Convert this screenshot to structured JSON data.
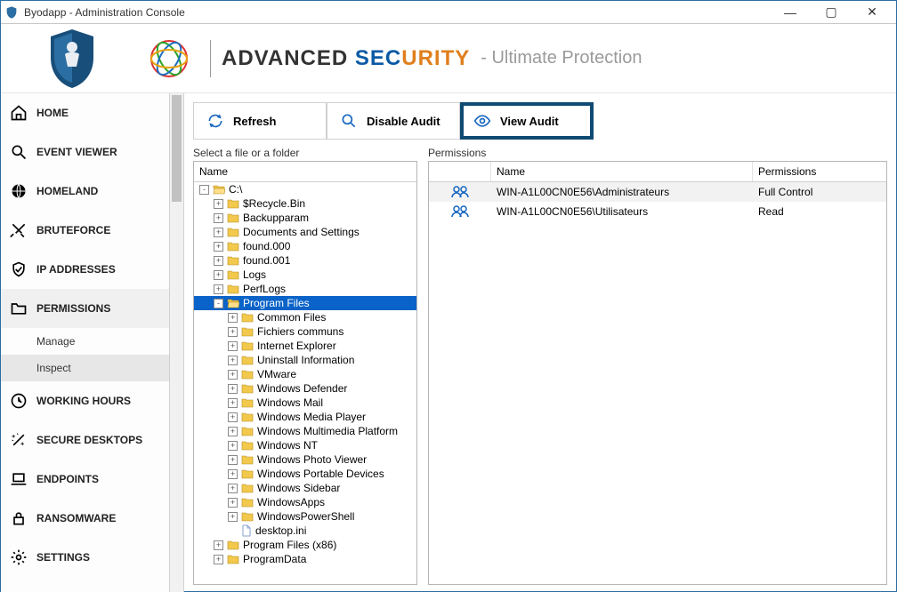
{
  "window": {
    "title": "Byodapp - Administration Console"
  },
  "brand": {
    "word1": "ADVANCED ",
    "word2a": "SEC",
    "word2b": "URITY",
    "tagline": "- Ultimate Protection"
  },
  "sidebar": {
    "items": [
      {
        "label": "HOME",
        "icon": "home-icon"
      },
      {
        "label": "EVENT VIEWER",
        "icon": "search-icon"
      },
      {
        "label": "HOMELAND",
        "icon": "globe-icon"
      },
      {
        "label": "BRUTEFORCE",
        "icon": "swords-icon"
      },
      {
        "label": "IP ADDRESSES",
        "icon": "shield-check-icon"
      },
      {
        "label": "PERMISSIONS",
        "icon": "folder-icon",
        "selected": true,
        "sub": [
          {
            "label": "Manage"
          },
          {
            "label": "Inspect",
            "selected": true
          }
        ]
      },
      {
        "label": "WORKING HOURS",
        "icon": "clock-icon"
      },
      {
        "label": "SECURE DESKTOPS",
        "icon": "wand-icon"
      },
      {
        "label": "ENDPOINTS",
        "icon": "laptop-icon"
      },
      {
        "label": "RANSOMWARE",
        "icon": "lock-icon"
      },
      {
        "label": "SETTINGS",
        "icon": "gear-icon"
      }
    ]
  },
  "toolbar": {
    "refresh": "Refresh",
    "disable_audit": "Disable Audit",
    "view_audit": "View Audit"
  },
  "left_panel": {
    "title": "Select a file or a folder",
    "header": "Name"
  },
  "right_panel": {
    "title": "Permissions",
    "col_name": "Name",
    "col_perm": "Permissions"
  },
  "tree": [
    {
      "depth": 0,
      "twisty": "-",
      "kind": "folder-open",
      "label": "C:\\"
    },
    {
      "depth": 1,
      "twisty": "+",
      "kind": "folder",
      "label": "$Recycle.Bin"
    },
    {
      "depth": 1,
      "twisty": "+",
      "kind": "folder",
      "label": "Backupparam"
    },
    {
      "depth": 1,
      "twisty": "+",
      "kind": "folder",
      "label": "Documents and Settings"
    },
    {
      "depth": 1,
      "twisty": "+",
      "kind": "folder",
      "label": "found.000"
    },
    {
      "depth": 1,
      "twisty": "+",
      "kind": "folder",
      "label": "found.001"
    },
    {
      "depth": 1,
      "twisty": "+",
      "kind": "folder",
      "label": "Logs"
    },
    {
      "depth": 1,
      "twisty": "+",
      "kind": "folder",
      "label": "PerfLogs"
    },
    {
      "depth": 1,
      "twisty": "-",
      "kind": "folder-open",
      "label": "Program Files",
      "selected": true
    },
    {
      "depth": 2,
      "twisty": "+",
      "kind": "folder",
      "label": "Common Files"
    },
    {
      "depth": 2,
      "twisty": "+",
      "kind": "folder",
      "label": "Fichiers communs"
    },
    {
      "depth": 2,
      "twisty": "+",
      "kind": "folder",
      "label": "Internet Explorer"
    },
    {
      "depth": 2,
      "twisty": "+",
      "kind": "folder",
      "label": "Uninstall Information"
    },
    {
      "depth": 2,
      "twisty": "+",
      "kind": "folder",
      "label": "VMware"
    },
    {
      "depth": 2,
      "twisty": "+",
      "kind": "folder",
      "label": "Windows Defender"
    },
    {
      "depth": 2,
      "twisty": "+",
      "kind": "folder",
      "label": "Windows Mail"
    },
    {
      "depth": 2,
      "twisty": "+",
      "kind": "folder",
      "label": "Windows Media Player"
    },
    {
      "depth": 2,
      "twisty": "+",
      "kind": "folder",
      "label": "Windows Multimedia Platform"
    },
    {
      "depth": 2,
      "twisty": "+",
      "kind": "folder",
      "label": "Windows NT"
    },
    {
      "depth": 2,
      "twisty": "+",
      "kind": "folder",
      "label": "Windows Photo Viewer"
    },
    {
      "depth": 2,
      "twisty": "+",
      "kind": "folder",
      "label": "Windows Portable Devices"
    },
    {
      "depth": 2,
      "twisty": "+",
      "kind": "folder",
      "label": "Windows Sidebar"
    },
    {
      "depth": 2,
      "twisty": "+",
      "kind": "folder",
      "label": "WindowsApps"
    },
    {
      "depth": 2,
      "twisty": "+",
      "kind": "folder",
      "label": "WindowsPowerShell"
    },
    {
      "depth": 2,
      "twisty": "",
      "kind": "file",
      "label": "desktop.ini"
    },
    {
      "depth": 1,
      "twisty": "+",
      "kind": "folder",
      "label": "Program Files (x86)"
    },
    {
      "depth": 1,
      "twisty": "+",
      "kind": "folder",
      "label": "ProgramData"
    }
  ],
  "permissions": [
    {
      "name": "WIN-A1L00CN0E56\\Administrateurs",
      "perm": "Full Control"
    },
    {
      "name": "WIN-A1L00CN0E56\\Utilisateurs",
      "perm": "Read"
    }
  ]
}
